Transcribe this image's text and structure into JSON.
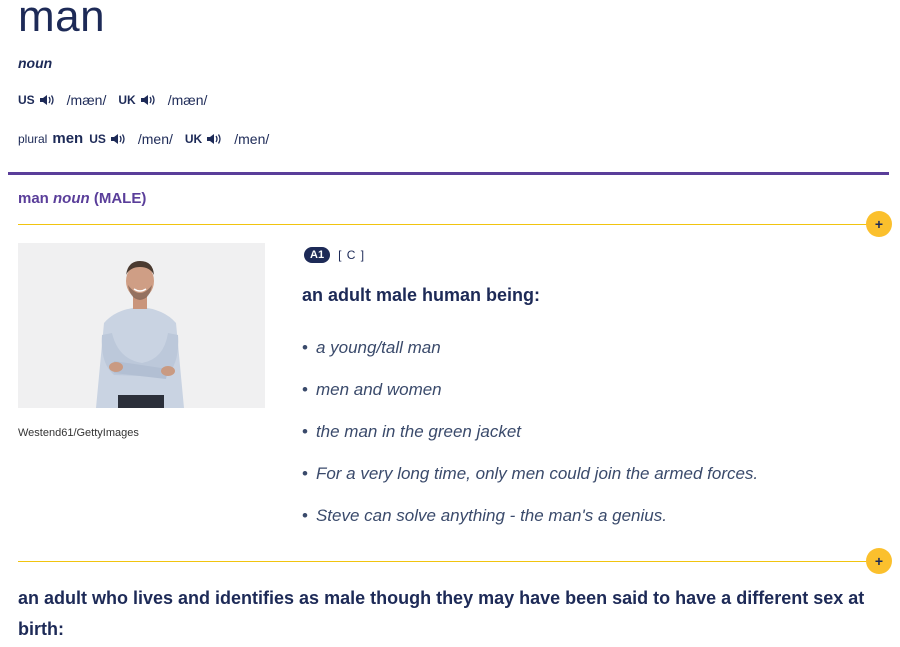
{
  "entry": {
    "headword": "man",
    "part_of_speech": "noun",
    "pronunciations": [
      {
        "region": "US",
        "ipa": "/mæn/"
      },
      {
        "region": "UK",
        "ipa": "/mæn/"
      }
    ],
    "plural": {
      "label": "plural",
      "word": "men",
      "pronunciations": [
        {
          "region": "US",
          "ipa": "/men/"
        },
        {
          "region": "UK",
          "ipa": "/men/"
        }
      ]
    }
  },
  "sense": {
    "headword": "man",
    "pos": "noun",
    "guideword": "(MALE)",
    "expand_icon": "+",
    "image_caption": "Westend61/GettyImages",
    "level": "A1",
    "grammar": "[ C ]",
    "definition": "an adult male human being:",
    "examples": [
      "a young/tall man",
      "men and women",
      "the man in the green jacket",
      "For a very long time, only men could join the armed forces.",
      "Steve can solve anything - the man's a genius."
    ]
  },
  "sense2": {
    "expand_icon": "+",
    "definition": "an adult who lives and identifies as male though they may have been said to have a different sex at birth:"
  },
  "colors": {
    "navy": "#1d2a57",
    "purple": "#5a3e9a",
    "gold": "#fbc02d"
  }
}
